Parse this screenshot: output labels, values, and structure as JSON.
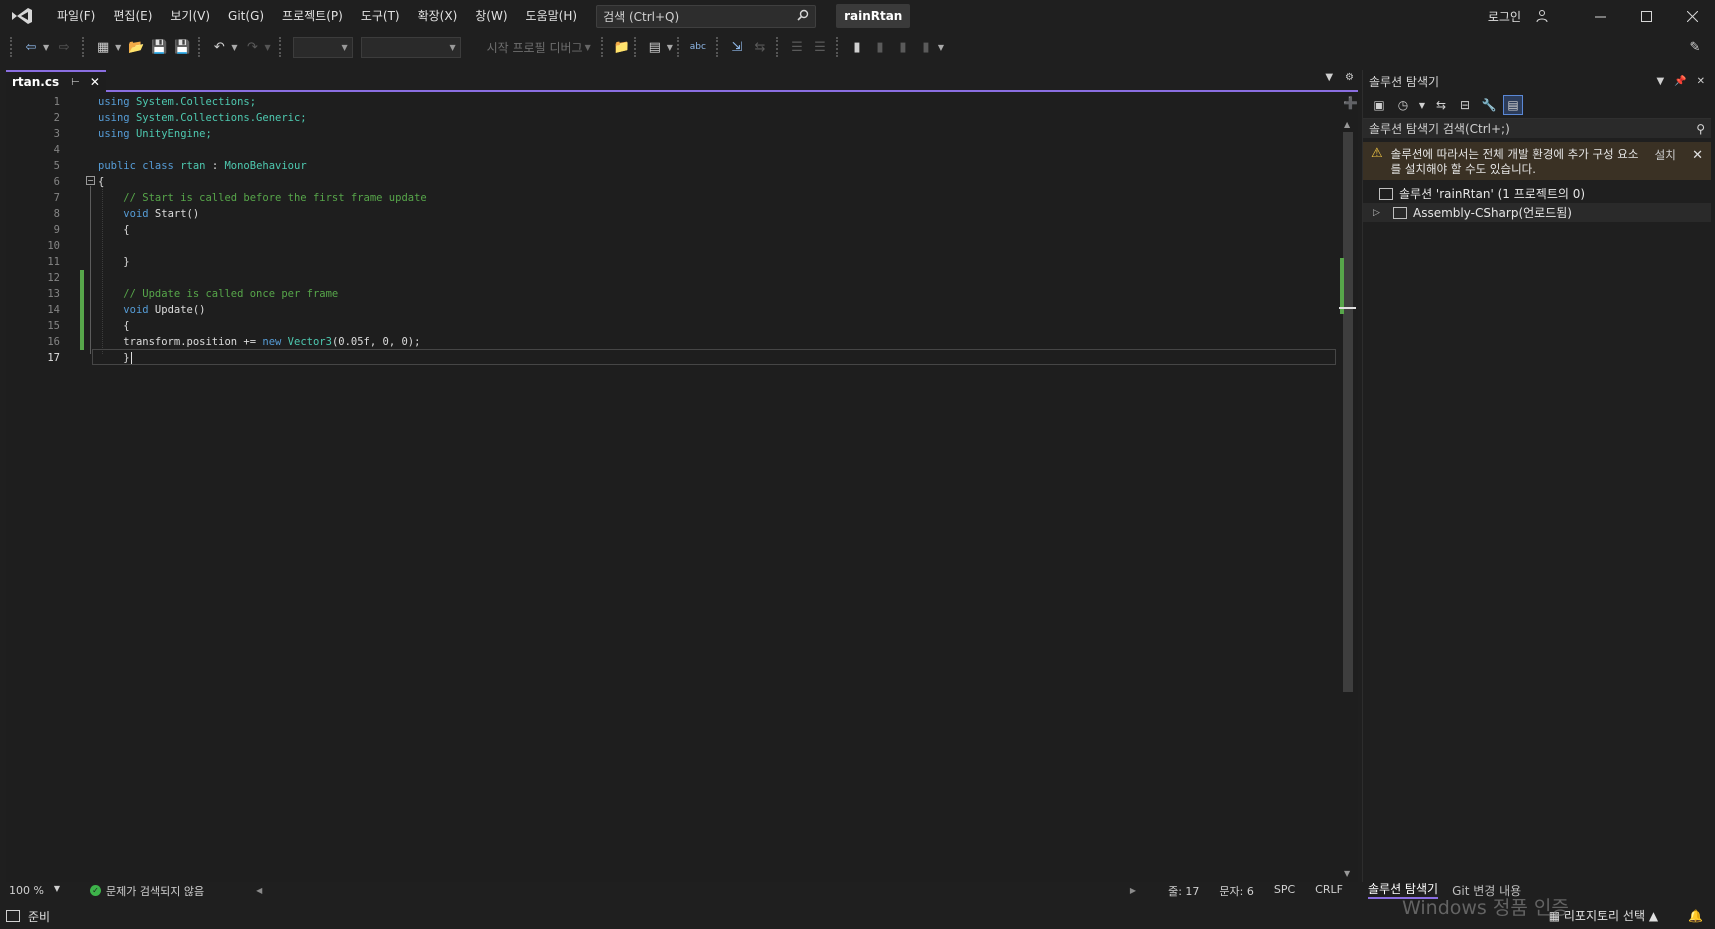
{
  "titlebar": {
    "menu": [
      "파일(F)",
      "편집(E)",
      "보기(V)",
      "Git(G)",
      "프로젝트(P)",
      "도구(T)",
      "확장(X)",
      "창(W)",
      "도움말(H)"
    ],
    "search_placeholder": "검색 (Ctrl+Q)",
    "project_name": "rainRtan",
    "login_label": "로그인"
  },
  "toolbar": {
    "start_profile_label": "시작 프로필 디버그"
  },
  "editor": {
    "tab_name": "rtan.cs",
    "line_numbers": [
      "1",
      "2",
      "3",
      "4",
      "5",
      "6",
      "7",
      "8",
      "9",
      "10",
      "11",
      "12",
      "13",
      "14",
      "15",
      "16",
      "17"
    ],
    "current_line": 17,
    "zoom": "100 %",
    "issues_label": "문제가 검색되지 않음",
    "line_info": "줄: 17",
    "col_info": "문자: 6",
    "whitespace": "SPC",
    "line_ending": "CRLF"
  },
  "code": {
    "l1_kw": "using",
    "l1_ns": "System.Collections;",
    "l2_kw": "using",
    "l2_ns": "System.Collections.Generic;",
    "l3_kw": "using",
    "l3_ns": "UnityEngine;",
    "l5_kw": "public class",
    "l5_name": "rtan",
    "l5_colon": ":",
    "l5_base": "MonoBehaviour",
    "l6": "{",
    "l7_comment": "// Start is called before the first frame update",
    "l8_kw": "void",
    "l8_rest": "Start()",
    "l9": "{",
    "l11": "}",
    "l13_comment": "// Update is called once per frame",
    "l14_kw": "void",
    "l14_rest": "Update()",
    "l15": "{",
    "l16_a": "transform.position += ",
    "l16_kw": "new",
    "l16_type": "Vector3",
    "l16_args": "(0.05f, 0, 0);",
    "l17": "}"
  },
  "solution_explorer": {
    "title": "솔루션 탐색기",
    "search_placeholder": "솔루션 탐색기 검색(Ctrl+;)",
    "warning_text": "솔루션에 따라서는 전체 개발 환경에 추가 구성 요소를 설치해야 할 수도 있습니다.",
    "install_label": "설치",
    "solution_item": "솔루션 'rainRtan' (1 프로젝트의 0)",
    "project_item": "Assembly-CSharp(언로드됨)",
    "bottom_tabs": [
      "솔루션 탐색기",
      "Git 변경 내용"
    ]
  },
  "statusbar": {
    "ready": "준비",
    "repo_select": "리포지토리 선택"
  },
  "watermark": {
    "line1": "Windows 정품 인증"
  },
  "colors": {
    "accent": "#8a6ee0",
    "keyword": "#569cd6",
    "type": "#4ec9b0",
    "comment": "#57a64a",
    "change_marker": "#57a64a",
    "warning_bg": "#3a3124"
  }
}
